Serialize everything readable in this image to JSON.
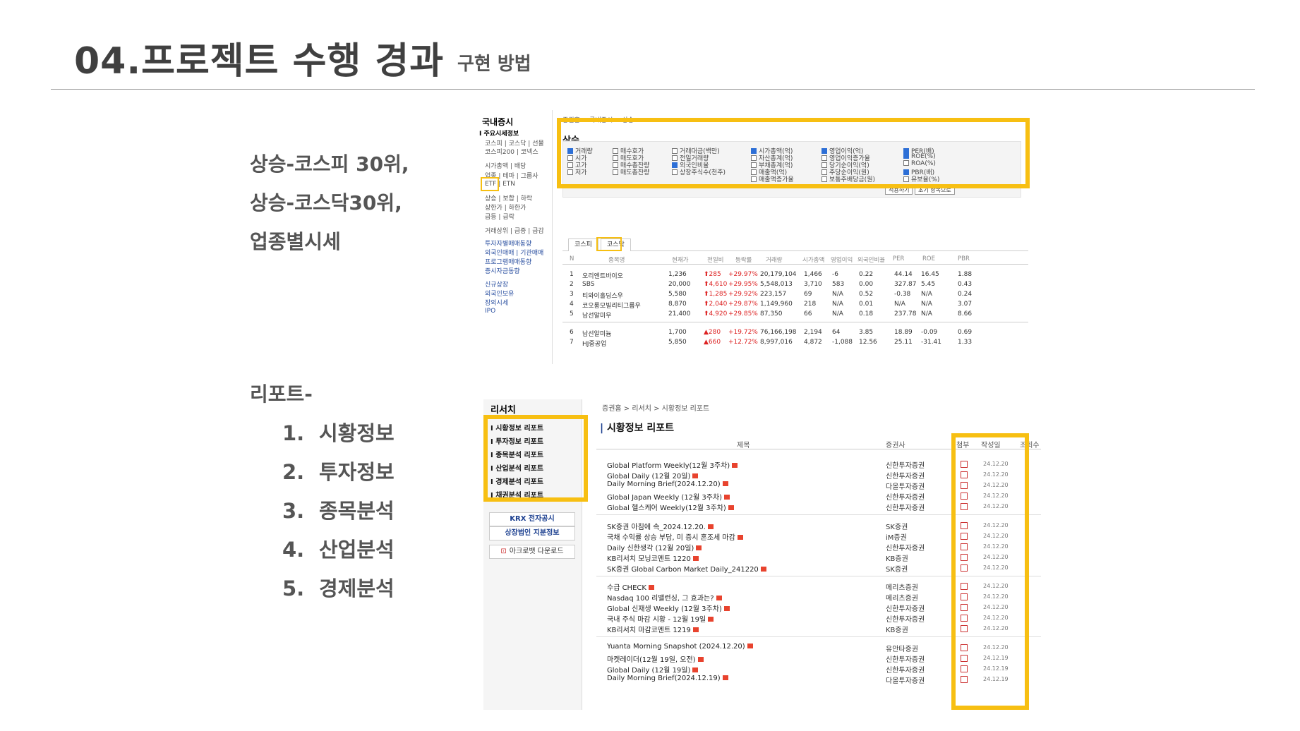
{
  "header": {
    "title": "04.프로젝트 수행 경과",
    "subtitle": "구현 방법"
  },
  "left_text": {
    "rise_lines": [
      "상승-코스피 30위,",
      "상승-코스닥30위,",
      "업종별시세"
    ],
    "report_label": "리포트-",
    "report_items": [
      {
        "num": "1.",
        "label": "시황정보"
      },
      {
        "num": "2.",
        "label": "투자정보"
      },
      {
        "num": "3.",
        "label": "종목분석"
      },
      {
        "num": "4.",
        "label": "산업분석"
      },
      {
        "num": "5.",
        "label": "경제분석"
      }
    ]
  },
  "shot1": {
    "sidebar_title": "국내증시",
    "sidebar_items": [
      "I 주요시세정보",
      "코스피 | 코스닥 | 선물",
      "코스피200 | 코넥스",
      "시가총액 | 배당",
      "업종 | 테마 | 그룹사",
      "ETF | ETN",
      "상승 | 보합 | 하락",
      "상한가 | 하한가",
      "급등 | 급락",
      "거래상위 | 급증 | 급감",
      "투자자별매매동향",
      "외국인매매 | 기관매매",
      "프로그램매매동향",
      "증시자금동향",
      "신규상장",
      "외국인보유",
      "장외시세",
      "IPO"
    ],
    "breadcrumb": "증권홈 > 국내증시 > 상승",
    "heading": "상승",
    "options": [
      [
        "거래량",
        "시가",
        "고가",
        "저가"
      ],
      [
        "매수호가",
        "매도호가",
        "매수총잔량",
        "매도총잔량"
      ],
      [
        "거래대금(백만)",
        "전일거래량",
        "외국인비율",
        "상장주식수(천주)"
      ],
      [
        "시가총액(억)",
        "자산총계(억)",
        "부채총계(억)",
        "매출액(억)",
        "매출액증가율"
      ],
      [
        "영업이익(억)",
        "영업이익증가율",
        "당기순이익(억)",
        "주당순이익(원)",
        "보통주배당금(원)"
      ],
      [
        "PER(배)",
        "ROE(%)",
        "ROA(%)",
        "PBR(배)",
        "유보율(%)"
      ]
    ],
    "checked": [
      [
        true,
        false,
        false,
        false
      ],
      [
        false,
        false,
        false,
        false
      ],
      [
        false,
        false,
        true,
        false
      ],
      [
        true,
        false,
        false,
        false,
        false
      ],
      [
        true,
        false,
        false,
        false,
        false
      ],
      [
        true,
        true,
        false,
        true,
        false
      ]
    ],
    "apply_button": "적용하기",
    "reset_button": "초기 항목으로",
    "tabs": [
      "코스피",
      "코스닥"
    ],
    "table_headers": [
      "N",
      "종목명",
      "현재가",
      "전일비",
      "등락률",
      "거래량",
      "시가총액",
      "영업이익",
      "외국인비율",
      "PER",
      "ROE",
      "PBR"
    ],
    "rows": [
      [
        "1",
        "오리엔트바이오",
        "1,236",
        "285",
        "+29.97%",
        "20,179,104",
        "1,466",
        "-6",
        "0.22",
        "44.14",
        "16.45",
        "1.88"
      ],
      [
        "2",
        "SBS",
        "20,000",
        "4,610",
        "+29.95%",
        "5,548,013",
        "3,710",
        "583",
        "0.00",
        "327.87",
        "5.45",
        "0.43"
      ],
      [
        "3",
        "티와이홀딩스우",
        "5,580",
        "1,285",
        "+29.92%",
        "223,157",
        "69",
        "N/A",
        "0.52",
        "-0.38",
        "N/A",
        "0.24"
      ],
      [
        "4",
        "코오롱모빌리티그룹우",
        "8,870",
        "2,040",
        "+29.87%",
        "1,149,960",
        "218",
        "N/A",
        "0.01",
        "N/A",
        "N/A",
        "3.07"
      ],
      [
        "5",
        "남선알미우",
        "21,400",
        "4,920",
        "+29.85%",
        "87,350",
        "66",
        "N/A",
        "0.18",
        "237.78",
        "N/A",
        "8.66"
      ],
      [
        "6",
        "남선알미늄",
        "1,700",
        "280",
        "+19.72%",
        "76,166,198",
        "2,194",
        "64",
        "3.85",
        "18.89",
        "-0.09",
        "0.69"
      ],
      [
        "7",
        "HJ중공업",
        "5,850",
        "660",
        "+12.72%",
        "8,997,016",
        "4,872",
        "-1,088",
        "12.56",
        "25.11",
        "-31.41",
        "1.33"
      ]
    ]
  },
  "shot2": {
    "sidebar_title": "리서치",
    "sidebar_items": [
      "I 시황정보 리포트",
      "I 투자정보 리포트",
      "I 종목분석 리포트",
      "I 산업분석 리포트",
      "I 경제분석 리포트",
      "I 채권분석 리포트"
    ],
    "krx_button": "KRX 전자공시",
    "stake_button": "상장법인 지분정보",
    "acrobat_button": "아크로뱃 다운로드",
    "breadcrumb": "증권홈 > 리서치 > 시황정보 리포트",
    "heading": "시황정보 리포트",
    "columns": [
      "제목",
      "증권사",
      "첨부",
      "작성일",
      "조회수"
    ],
    "rows": [
      [
        "Global Platform Weekly(12월 3주차)",
        "신한투자증권",
        "24.12.20"
      ],
      [
        "Global Daily (12월 20일)",
        "신한투자증권",
        "24.12.20"
      ],
      [
        "Daily Morning Brief(2024.12.20)",
        "다올투자증권",
        "24.12.20"
      ],
      [
        "Global Japan Weekly (12월 3주차)",
        "신한투자증권",
        "24.12.20"
      ],
      [
        "Global 헬스케어 Weekly(12월 3주차)",
        "신한투자증권",
        "24.12.20"
      ],
      [
        "SK증권 아침에 속_2024.12.20.",
        "SK증권",
        "24.12.20"
      ],
      [
        "국채 수익률 상승 부담, 미 증시 혼조세 마감",
        "iM증권",
        "24.12.20"
      ],
      [
        "Daily 신한생각 (12월 20일)",
        "신한투자증권",
        "24.12.20"
      ],
      [
        "KB리서치 모닝코멘트 1220",
        "KB증권",
        "24.12.20"
      ],
      [
        "SK증권 Global Carbon Market Daily_241220",
        "SK증권",
        "24.12.20"
      ],
      [
        "수급 CHECK",
        "메리츠증권",
        "24.12.20"
      ],
      [
        "Nasdaq 100 리밸런싱, 그 효과는?",
        "메리츠증권",
        "24.12.20"
      ],
      [
        "Global 신재생 Weekly (12월 3주차)",
        "신한투자증권",
        "24.12.20"
      ],
      [
        "국내 주식 마감 시황 - 12월 19일",
        "신한투자증권",
        "24.12.20"
      ],
      [
        "KB리서치 마감코멘트 1219",
        "KB증권",
        "24.12.20"
      ],
      [
        "Yuanta Morning Snapshot (2024.12.20)",
        "유안타증권",
        "24.12.20"
      ],
      [
        "마켓레이더(12월 19일, 오전)",
        "신한투자증권",
        "24.12.19"
      ],
      [
        "Global Daily (12월 19일)",
        "신한투자증권",
        "24.12.19"
      ],
      [
        "Daily Morning Brief(2024.12.19)",
        "다올투자증권",
        "24.12.19"
      ]
    ]
  },
  "colors": {
    "highlight": "#f7bf12",
    "up": "#d22222"
  }
}
